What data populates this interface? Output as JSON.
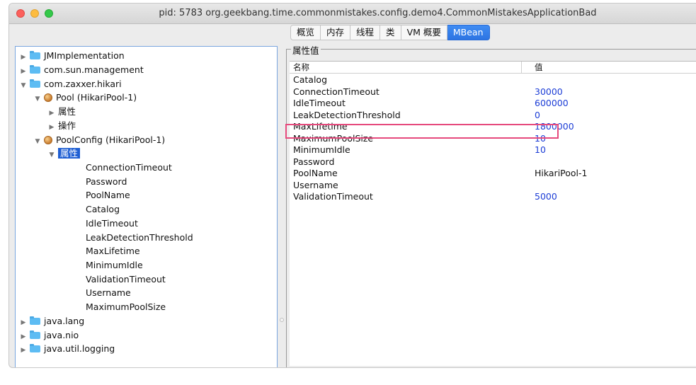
{
  "window": {
    "title": "pid: 5783 org.geekbang.time.commonmistakes.config.demo4.CommonMistakesApplicationBad"
  },
  "tabs": [
    {
      "label": "概览",
      "active": false
    },
    {
      "label": "内存",
      "active": false
    },
    {
      "label": "线程",
      "active": false
    },
    {
      "label": "类",
      "active": false
    },
    {
      "label": "VM 概要",
      "active": false
    },
    {
      "label": "MBean",
      "active": true
    }
  ],
  "tree": [
    {
      "label": "JMImplementation",
      "arrow": "▶",
      "icon": "folder-icon"
    },
    {
      "label": "com.sun.management",
      "arrow": "▶",
      "icon": "folder-icon"
    },
    {
      "label": "com.zaxxer.hikari",
      "arrow": "▼",
      "icon": "folder-icon"
    },
    {
      "label": "Pool (HikariPool-1)",
      "arrow": "▼",
      "icon": "bean-icon"
    },
    {
      "label": "属性",
      "arrow": "▶",
      "icon": ""
    },
    {
      "label": "操作",
      "arrow": "▶",
      "icon": ""
    },
    {
      "label": "PoolConfig (HikariPool-1)",
      "arrow": "▼",
      "icon": "bean-icon"
    },
    {
      "label": "属性",
      "arrow": "▼",
      "icon": "",
      "selected": true
    },
    {
      "label": "ConnectionTimeout",
      "arrow": "",
      "icon": ""
    },
    {
      "label": "Password",
      "arrow": "",
      "icon": ""
    },
    {
      "label": "PoolName",
      "arrow": "",
      "icon": ""
    },
    {
      "label": "Catalog",
      "arrow": "",
      "icon": ""
    },
    {
      "label": "IdleTimeout",
      "arrow": "",
      "icon": ""
    },
    {
      "label": "LeakDetectionThreshold",
      "arrow": "",
      "icon": ""
    },
    {
      "label": "MaxLifetime",
      "arrow": "",
      "icon": ""
    },
    {
      "label": "MinimumIdle",
      "arrow": "",
      "icon": ""
    },
    {
      "label": "ValidationTimeout",
      "arrow": "",
      "icon": ""
    },
    {
      "label": "Username",
      "arrow": "",
      "icon": ""
    },
    {
      "label": "MaximumPoolSize",
      "arrow": "",
      "icon": ""
    },
    {
      "label": "java.lang",
      "arrow": "▶",
      "icon": "folder-icon"
    },
    {
      "label": "java.nio",
      "arrow": "▶",
      "icon": "folder-icon"
    },
    {
      "label": "java.util.logging",
      "arrow": "▶",
      "icon": "folder-icon"
    }
  ],
  "attributes": {
    "legend": "属性值",
    "header_name": "名称",
    "header_value": "值",
    "rows": [
      {
        "name": "Catalog",
        "value": ""
      },
      {
        "name": "ConnectionTimeout",
        "value": "30000"
      },
      {
        "name": "IdleTimeout",
        "value": "600000"
      },
      {
        "name": "LeakDetectionThreshold",
        "value": "0"
      },
      {
        "name": "MaxLifetime",
        "value": "1800000"
      },
      {
        "name": "MaximumPoolSize",
        "value": "10",
        "highlighted": true
      },
      {
        "name": "MinimumIdle",
        "value": "10"
      },
      {
        "name": "Password",
        "value": ""
      },
      {
        "name": "PoolName",
        "value": "HikariPool-1",
        "plain": true
      },
      {
        "name": "Username",
        "value": ""
      },
      {
        "name": "ValidationTimeout",
        "value": "5000"
      }
    ]
  },
  "colors": {
    "accent": "#2d74e2",
    "value_text": "#1c3dd6",
    "highlight_box": "#e64a7d"
  }
}
